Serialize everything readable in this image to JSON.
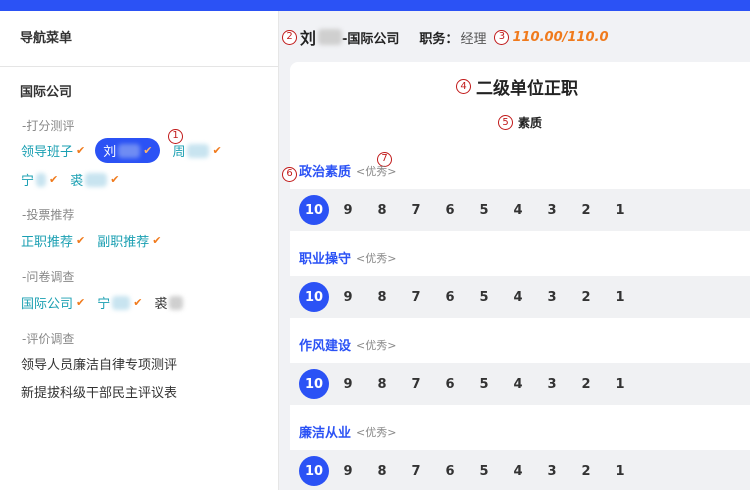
{
  "sidebar": {
    "header": "导航菜单",
    "org": "国际公司",
    "groups": {
      "scoring": "-打分测评",
      "voting": "-投票推荐",
      "survey": "-问卷调查",
      "evaluation": "-评价调查"
    },
    "scoring_items": {
      "leadership": "领导班子",
      "liu": "刘",
      "zhou": "周",
      "ning": "宁",
      "qiu": "裘"
    },
    "voting_items": {
      "zhengzhi": "正职推荐",
      "fuzhi": "副职推荐"
    },
    "survey_items": {
      "intl": "国际公司",
      "ning": "宁",
      "qiu": "裘"
    },
    "evaluation_links": {
      "link1": "领导人员廉洁自律专项测评",
      "link2": "新提拔科级干部民主评议表"
    },
    "check_glyph": "✔"
  },
  "header": {
    "name": "刘",
    "org": "-国际公司",
    "position_label": "职务：",
    "position": "经理",
    "score": "110.00/110.0"
  },
  "card": {
    "title": "二级单位正职",
    "subtitle": "素质"
  },
  "markers": {
    "m1": "1",
    "m2": "2",
    "m3": "3",
    "m4": "4",
    "m5": "5",
    "m6": "6",
    "m7": "7"
  },
  "sections": [
    {
      "name": "政治素质",
      "rating": "<优秀>"
    },
    {
      "name": "职业操守",
      "rating": "<优秀>"
    },
    {
      "name": "作风建设",
      "rating": "<优秀>"
    },
    {
      "name": "廉洁从业",
      "rating": "<优秀>"
    }
  ],
  "scores": [
    "10",
    "9",
    "8",
    "7",
    "6",
    "5",
    "4",
    "3",
    "2",
    "1"
  ],
  "selected_score": "10",
  "colors": {
    "accent": "#2b52f5",
    "teal_link": "#1a9fb2",
    "check": "#f07a1c",
    "score_text": "#f07a1c",
    "marker": "#c11a1a"
  }
}
